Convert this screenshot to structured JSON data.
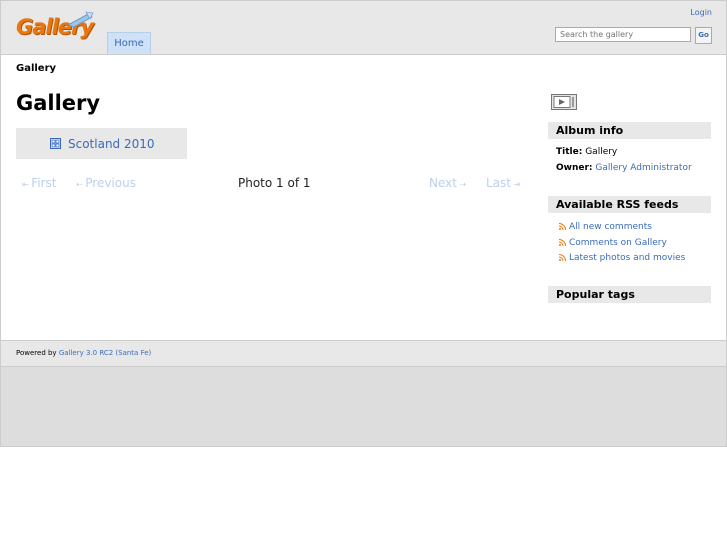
{
  "header": {
    "logo_text": "Gallery",
    "login_label": "Login",
    "search_placeholder": "Search the gallery",
    "search_button": "Go",
    "nav": {
      "home_label": "Home"
    }
  },
  "breadcrumb": "Gallery",
  "page_title": "Gallery",
  "album": {
    "name": "Scotland 2010"
  },
  "pager": {
    "first": "First",
    "previous": "Previous",
    "status": "Photo 1 of 1",
    "next": "Next",
    "last": "Last"
  },
  "sidebar": {
    "album_info": {
      "heading": "Album info",
      "title_label": "Title:",
      "title_value": "Gallery",
      "owner_label": "Owner:",
      "owner_value": "Gallery Administrator"
    },
    "rss": {
      "heading": "Available RSS feeds",
      "items": [
        "All new comments",
        "Comments on Gallery",
        "Latest photos and movies"
      ]
    },
    "tags": {
      "heading": "Popular tags"
    }
  },
  "footer": {
    "powered_by": "Powered by",
    "version_link": "Gallery 3.0 RC2 (Santa Fe)"
  },
  "colors": {
    "link": "#3b6bb8",
    "logo": "#e8770f",
    "tab_active": "#cde1f7",
    "pager_disabled": "#bcd0ea"
  }
}
